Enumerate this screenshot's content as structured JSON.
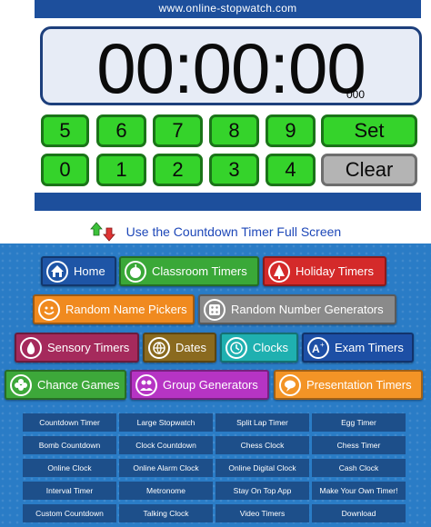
{
  "header": {
    "site": "www.online-stopwatch.com"
  },
  "display": {
    "time": "00:00:00",
    "ms": "000"
  },
  "keypad": {
    "row1": [
      "5",
      "6",
      "7",
      "8",
      "9"
    ],
    "row2": [
      "0",
      "1",
      "2",
      "3",
      "4"
    ],
    "set_label": "Set",
    "clear_label": "Clear"
  },
  "fullscreen": {
    "label": "Use the Countdown Timer Full Screen"
  },
  "nav": {
    "home": "Home",
    "classroom_timers": "Classroom Timers",
    "holiday_timers": "Holiday Timers",
    "random_name_pickers": "Random Name Pickers",
    "random_number_generators": "Random Number Generators",
    "sensory_timers": "Sensory Timers",
    "dates": "Dates",
    "clocks": "Clocks",
    "exam_timers": "Exam Timers",
    "chance_games": "Chance Games",
    "group_generators": "Group Generators",
    "presentation_timers": "Presentation Timers"
  },
  "links": [
    "Countdown Timer",
    "Large Stopwatch",
    "Split Lap Timer",
    "Egg Timer",
    "Bomb Countdown",
    "Clock Countdown",
    "Chess Clock",
    "Chess Timer",
    "Online Clock",
    "Online Alarm Clock",
    "Online Digital Clock",
    "Cash Clock",
    "Interval Timer",
    "Metronome",
    "Stay On Top App",
    "Make Your Own Timer!",
    "Custom Countdown",
    "Talking Clock",
    "Video Timers",
    "Download"
  ],
  "colors": {
    "header_blue": "#1d4f9c",
    "key_green": "#35d32b",
    "clear_grey": "#b4b4b4",
    "nav_blue_bg": "#2a7cc6"
  },
  "icons": {
    "fullscreen": "up-down-arrows-icon",
    "home": "house-icon",
    "classroom": "apple-icon",
    "holiday": "tree-icon",
    "random_names": "face-icon",
    "random_numbers": "dice-icon",
    "sensory": "drop-icon",
    "dates": "globe-icon",
    "clocks": "clock-icon",
    "exam": "grade-a-plus-icon",
    "chance": "clover-icon",
    "group": "people-icon",
    "presentation": "speech-bubble-icon"
  }
}
